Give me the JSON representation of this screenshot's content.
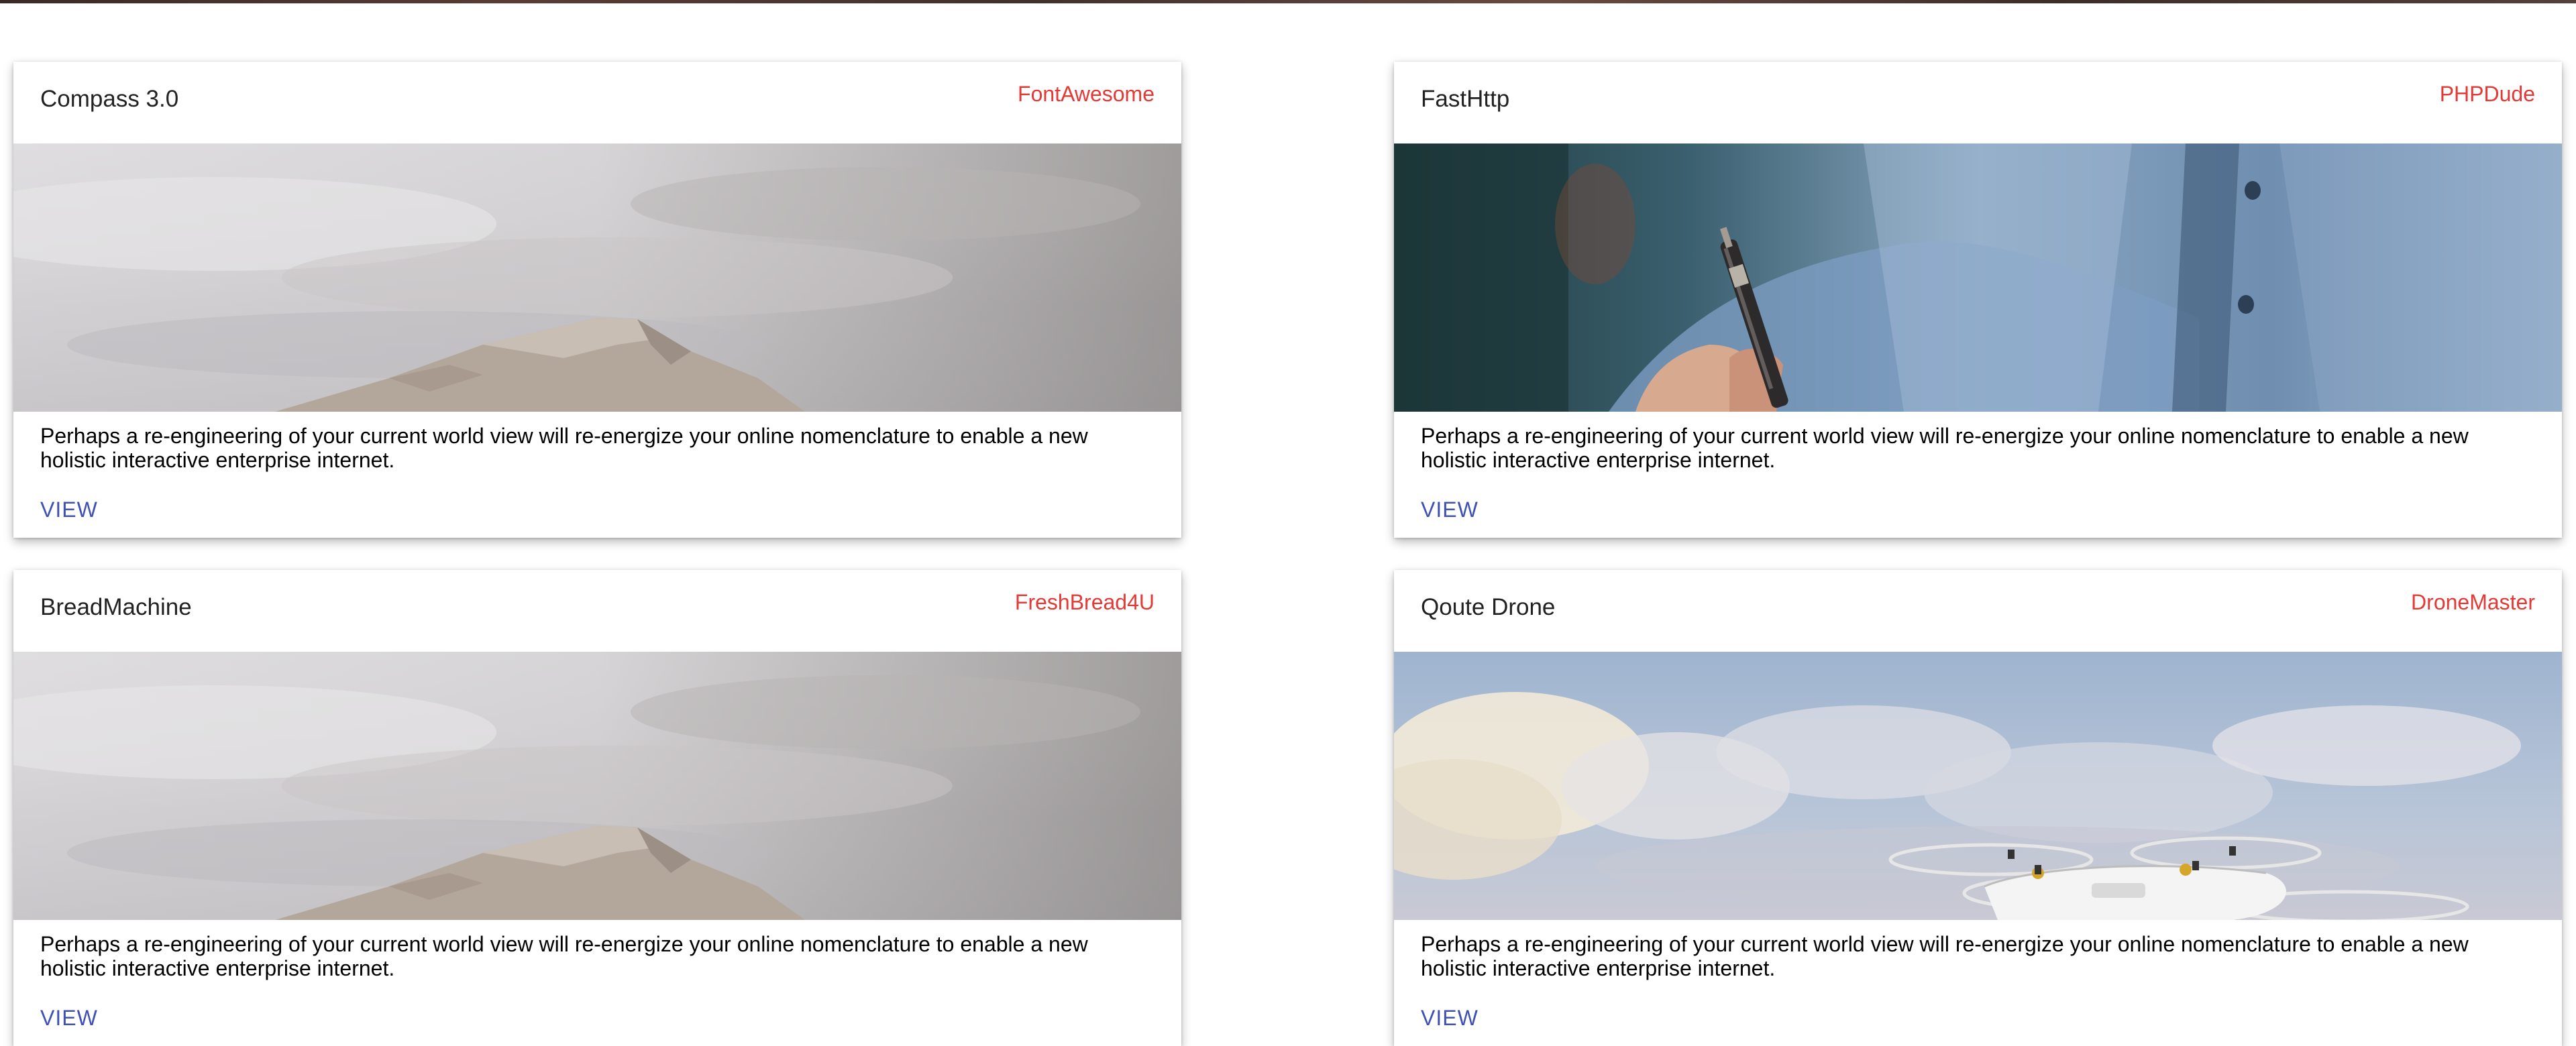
{
  "cards": [
    {
      "title": "Compass 3.0",
      "author": "FontAwesome",
      "image_icon": "mountain-clouds-image",
      "description": "Perhaps a re-engineering of your current world view will re-energize your online nomenclature to enable a new holistic interactive enterprise internet.",
      "action_label": "VIEW"
    },
    {
      "title": "FastHttp",
      "author": "PHPDude",
      "image_icon": "hand-writing-pen-image",
      "description": "Perhaps a re-engineering of your current world view will re-energize your online nomenclature to enable a new holistic interactive enterprise internet.",
      "action_label": "VIEW"
    },
    {
      "title": "BreadMachine",
      "author": "FreshBread4U",
      "image_icon": "mountain-clouds-image",
      "description": "Perhaps a re-engineering of your current world view will re-energize your online nomenclature to enable a new holistic interactive enterprise internet.",
      "action_label": "VIEW"
    },
    {
      "title": "Qoute Drone",
      "author": "DroneMaster",
      "image_icon": "drone-sky-image",
      "description": "Perhaps a re-engineering of your current world view will re-energize your online nomenclature to enable a new holistic interactive enterprise internet.",
      "action_label": "VIEW"
    }
  ],
  "colors": {
    "author": "#e53935",
    "action": "#3f51b5",
    "title": "#222222"
  }
}
